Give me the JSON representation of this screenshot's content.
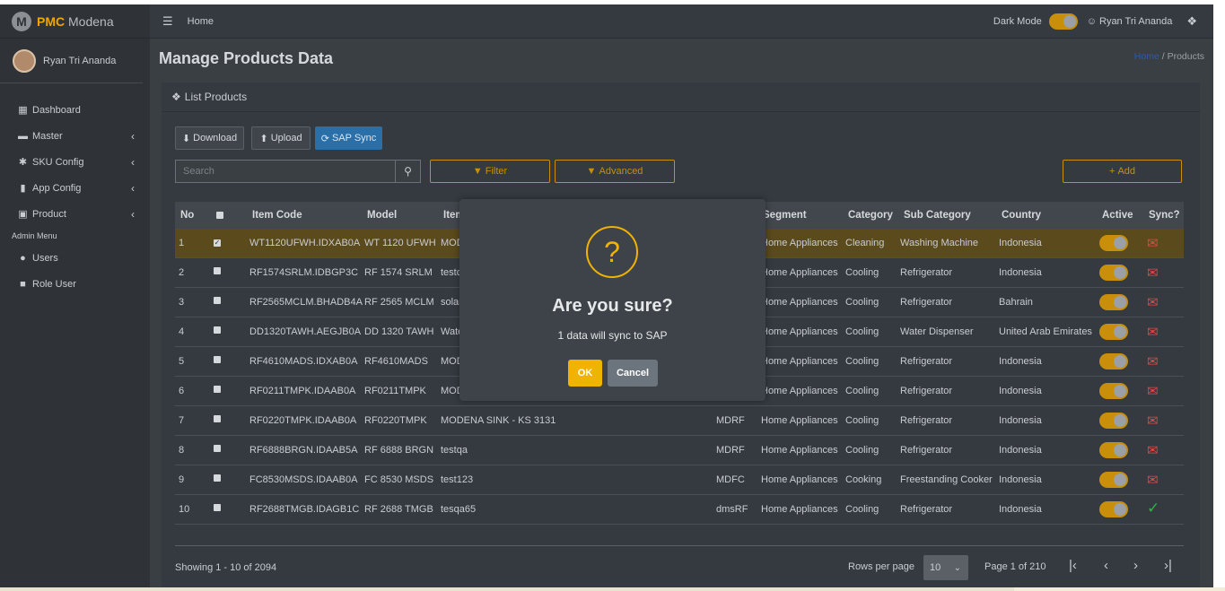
{
  "brand": {
    "accent": "PMC",
    "name": "Modena",
    "logo_letter": "M"
  },
  "sidebar": {
    "user_name": "Ryan Tri Ananda",
    "items": [
      {
        "label": "Dashboard",
        "icon": "grid-icon",
        "glyph": "▦"
      },
      {
        "label": "Master",
        "icon": "car-icon",
        "glyph": "▬"
      },
      {
        "label": "SKU Config",
        "icon": "gear-icon",
        "glyph": "✱"
      },
      {
        "label": "App Config",
        "icon": "mobile-icon",
        "glyph": "▮"
      },
      {
        "label": "Product",
        "icon": "briefcase-icon",
        "glyph": "▣"
      }
    ],
    "admin_header": "Admin Menu",
    "admin_items": [
      {
        "label": "Users",
        "icon": "users-icon",
        "glyph": "👥"
      },
      {
        "label": "Role User",
        "icon": "lock-icon",
        "glyph": "🔒"
      }
    ]
  },
  "topbar": {
    "home": "Home",
    "dark_mode_label": "Dark Mode",
    "dark_mode_on": true,
    "user": "Ryan Tri Ananda"
  },
  "page": {
    "title": "Manage Products Data",
    "breadcrumb_home": "Home",
    "breadcrumb_sep": "/",
    "breadcrumb_current": "Products"
  },
  "card": {
    "title": "List Products"
  },
  "toolbar": {
    "download": "Download",
    "upload": "Upload",
    "sap_sync": "SAP Sync",
    "search_placeholder": "Search",
    "filter": "Filter",
    "advanced": "Advanced",
    "add": "Add"
  },
  "table": {
    "headers": [
      "No",
      "",
      "Item Code",
      "Model",
      "Item",
      "Segment",
      "Category",
      "Sub Category",
      "Country",
      "Active",
      "Sync?"
    ],
    "rows": [
      {
        "no": "1",
        "checked": true,
        "code": "WT1120UFWH.IDXAB0A",
        "model": "WT 1120 UFWH",
        "item": "MOD",
        "brand": "",
        "segment": "Home Appliances",
        "category": "Cleaning",
        "sub": "Washing Machine",
        "country": "Indonesia",
        "synced": false
      },
      {
        "no": "2",
        "checked": false,
        "code": "RF1574SRLM.IDBGP3C",
        "model": "RF 1574 SRLM",
        "item": "testc",
        "brand": "",
        "segment": "Home Appliances",
        "category": "Cooling",
        "sub": "Refrigerator",
        "country": "Indonesia",
        "synced": false
      },
      {
        "no": "3",
        "checked": false,
        "code": "RF2565MCLM.BHADB4A",
        "model": "RF 2565 MCLM",
        "item": "solar",
        "brand": "",
        "segment": "Home Appliances",
        "category": "Cooling",
        "sub": "Refrigerator",
        "country": "Bahrain",
        "synced": false
      },
      {
        "no": "4",
        "checked": false,
        "code": "DD1320TAWH.AEGJB0A",
        "model": "DD 1320 TAWH",
        "item": "Wate",
        "brand": "",
        "segment": "Home Appliances",
        "category": "Cooling",
        "sub": "Water Dispenser",
        "country": "United Arab Emirates",
        "synced": false
      },
      {
        "no": "5",
        "checked": false,
        "code": "RF4610MADS.IDXAB0A",
        "model": "RF4610MADS",
        "item": "MOD",
        "brand": "",
        "segment": "Home Appliances",
        "category": "Cooling",
        "sub": "Refrigerator",
        "country": "Indonesia",
        "synced": false
      },
      {
        "no": "6",
        "checked": false,
        "code": "RF0211TMPK.IDAAB0A",
        "model": "RF0211TMPK",
        "item": "MOD",
        "brand": "",
        "segment": "Home Appliances",
        "category": "Cooling",
        "sub": "Refrigerator",
        "country": "Indonesia",
        "synced": false
      },
      {
        "no": "7",
        "checked": false,
        "code": "RF0220TMPK.IDAAB0A",
        "model": "RF0220TMPK",
        "item": "MODENA SINK - KS 3131",
        "brand": "MDRF",
        "segment": "Home Appliances",
        "category": "Cooling",
        "sub": "Refrigerator",
        "country": "Indonesia",
        "synced": false
      },
      {
        "no": "8",
        "checked": false,
        "code": "RF6888BRGN.IDAAB5A",
        "model": "RF 6888 BRGN",
        "item": "testqa",
        "brand": "MDRF",
        "segment": "Home Appliances",
        "category": "Cooling",
        "sub": "Refrigerator",
        "country": "Indonesia",
        "synced": false
      },
      {
        "no": "9",
        "checked": false,
        "code": "FC8530MSDS.IDAAB0A",
        "model": "FC 8530 MSDS",
        "item": "test123",
        "brand": "MDFC",
        "segment": "Home Appliances",
        "category": "Cooking",
        "sub": "Freestanding Cooker",
        "country": "Indonesia",
        "synced": false
      },
      {
        "no": "10",
        "checked": false,
        "code": "RF2688TMGB.IDAGB1C",
        "model": "RF 2688 TMGB",
        "item": "tesqa65",
        "brand": "dmsRF",
        "segment": "Home Appliances",
        "category": "Cooling",
        "sub": "Refrigerator",
        "country": "Indonesia",
        "synced": true
      }
    ]
  },
  "footer": {
    "showing": "Showing 1 - 10 of 2094",
    "rows_per_page_label": "Rows per page",
    "rows_per_page": "10",
    "page_info": "Page 1 of 210"
  },
  "modal": {
    "title": "Are you sure?",
    "text": "1 data will sync to SAP",
    "ok": "OK",
    "cancel": "Cancel"
  },
  "colors": {
    "accent": "#c98f0a",
    "sap_blue": "#2a6fa8",
    "warning": "#f0b400",
    "sync_fail": "#e04848",
    "sync_ok": "#2fb344"
  }
}
